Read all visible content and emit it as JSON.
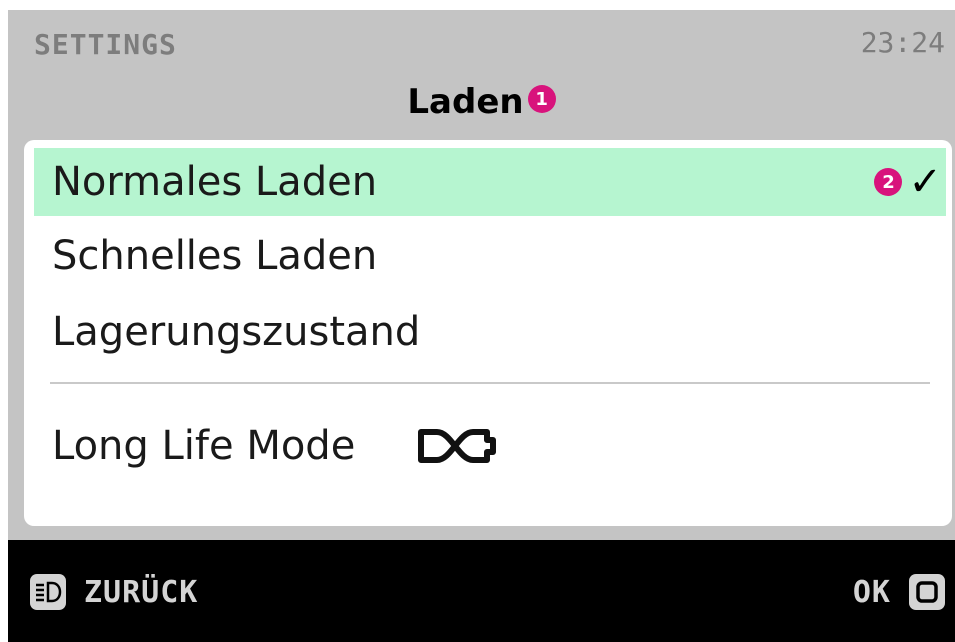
{
  "header": {
    "section_label": "SETTINGS",
    "time": "23:24",
    "title": "Laden",
    "title_badge": "1"
  },
  "menu": {
    "items": [
      {
        "label": "Normales Laden",
        "selected": true,
        "badge": "2",
        "checkmark": "✓"
      },
      {
        "label": "Schnelles Laden",
        "selected": false
      },
      {
        "label": "Lagerungszustand",
        "selected": false
      },
      {
        "label": "Long Life Mode",
        "selected": false,
        "icon": "infinity-battery-icon"
      }
    ]
  },
  "footer": {
    "back_label": "ZURÜCK",
    "back_icon": "light-button-icon",
    "ok_label": "OK",
    "ok_icon": "square-button-icon"
  },
  "colors": {
    "screen_bg": "#c4c4c4",
    "selected_bg": "#b6f5d0",
    "badge": "#d8137c",
    "bottom_bar": "#000000"
  }
}
